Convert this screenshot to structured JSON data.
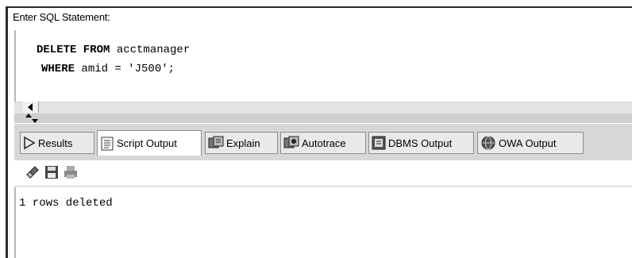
{
  "sql_panel": {
    "label": "Enter SQL Statement:",
    "line1_kw": "DELETE FROM",
    "line1_rest": " acctmanager",
    "line2_kw": "WHERE",
    "line2_rest": " amid = 'J500';"
  },
  "tabs": [
    {
      "label": "Results",
      "icon": "play-triangle-icon"
    },
    {
      "label": "Script Output",
      "icon": "script-output-icon"
    },
    {
      "label": "Explain",
      "icon": "explain-icon"
    },
    {
      "label": "Autotrace",
      "icon": "autotrace-icon"
    },
    {
      "label": "DBMS Output",
      "icon": "dbms-output-icon"
    },
    {
      "label": "OWA Output",
      "icon": "owa-output-icon"
    }
  ],
  "toolbar": {
    "icons": [
      "eraser-icon",
      "save-icon",
      "print-icon"
    ]
  },
  "output": {
    "text": "1 rows deleted"
  }
}
